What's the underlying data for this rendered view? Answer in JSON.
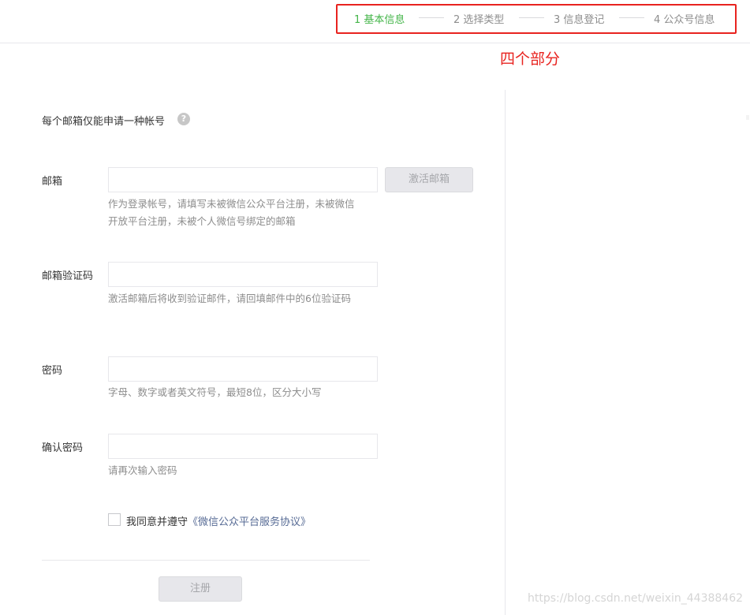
{
  "steps": [
    {
      "label": "1 基本信息",
      "active": true
    },
    {
      "label": "2 选择类型",
      "active": false
    },
    {
      "label": "3 信息登记",
      "active": false
    },
    {
      "label": "4 公众号信息",
      "active": false
    }
  ],
  "annotation": "四个部分",
  "form": {
    "tip": "每个邮箱仅能申请一种帐号",
    "email": {
      "label": "邮箱",
      "value": "",
      "hint": "作为登录帐号，请填写未被微信公众平台注册，未被微信开放平台注册，未被个人微信号绑定的邮箱",
      "activate_label": "激活邮箱"
    },
    "verify_code": {
      "label": "邮箱验证码",
      "value": "",
      "hint": "激活邮箱后将收到验证邮件，请回填邮件中的6位验证码"
    },
    "password": {
      "label": "密码",
      "value": "",
      "hint": "字母、数字或者英文符号，最短8位，区分大小写"
    },
    "confirm_password": {
      "label": "确认密码",
      "value": "",
      "hint": "请再次输入密码"
    },
    "agreement": {
      "prefix": "我同意并遵守",
      "link": "《微信公众平台服务协议》",
      "checked": false
    },
    "register_label": "注册"
  },
  "watermark": "https://blog.csdn.net/weixin_44388462",
  "colors": {
    "active_step": "#44b549",
    "annotation": "#e8231f",
    "link": "#576b95"
  }
}
